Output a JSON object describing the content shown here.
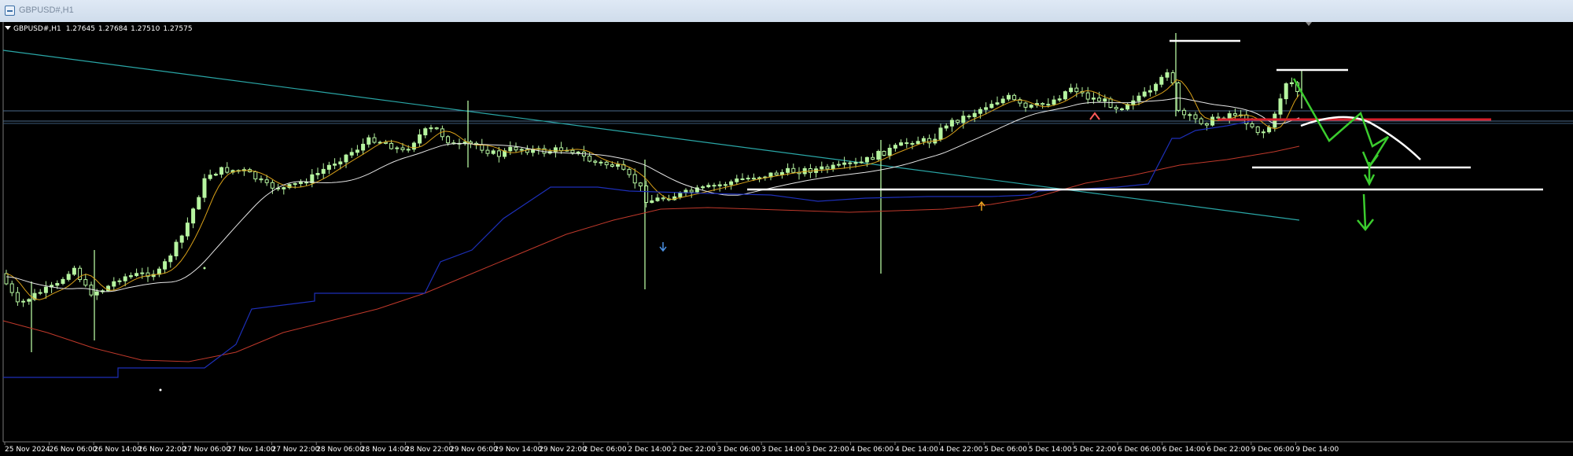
{
  "window": {
    "title": "GBPUSD#,H1"
  },
  "header": {
    "symbol": "GBPUSD#,H1",
    "open": "1.27645",
    "high": "1.27684",
    "low": "1.27510",
    "close": "1.27575"
  },
  "colors": {
    "background": "#000000",
    "candle": "#b6f5a0",
    "ma_fast": "#d8a018",
    "ma_mid": "#e6e6e6",
    "ma_slow": "#c0392b",
    "ma_step": "#1d2fb8",
    "trendline": "#2aa7a7",
    "drawing_white": "#ffffff",
    "drawing_green": "#3bcc2e",
    "drawing_red": "#d61f2a"
  },
  "chart_data": {
    "type": "candlestick",
    "timeframe": "H1",
    "x_tick_labels": [
      "25 Nov 2024",
      "26 Nov 06:00",
      "26 Nov 14:00",
      "26 Nov 22:00",
      "27 Nov 06:00",
      "27 Nov 14:00",
      "27 Nov 22:00",
      "28 Nov 06:00",
      "28 Nov 14:00",
      "28 Nov 22:00",
      "29 Nov 06:00",
      "29 Nov 14:00",
      "29 Nov 22:00",
      "2 Dec 06:00",
      "2 Dec 14:00",
      "2 Dec 22:00",
      "3 Dec 06:00",
      "3 Dec 14:00",
      "3 Dec 22:00",
      "4 Dec 06:00",
      "4 Dec 14:00",
      "4 Dec 22:00",
      "5 Dec 06:00",
      "5 Dec 14:00",
      "5 Dec 22:00",
      "6 Dec 06:00",
      "6 Dec 14:00",
      "6 Dec 22:00",
      "9 Dec 06:00",
      "9 Dec 14:00"
    ],
    "grid": false,
    "indicators": [
      "fast moving average",
      "medium moving average",
      "slow moving average",
      "step line",
      "long trendline"
    ],
    "drawings": [
      "horizontal support/resistance lines",
      "projected zig-zag path",
      "projected arc",
      "down arrows"
    ]
  }
}
